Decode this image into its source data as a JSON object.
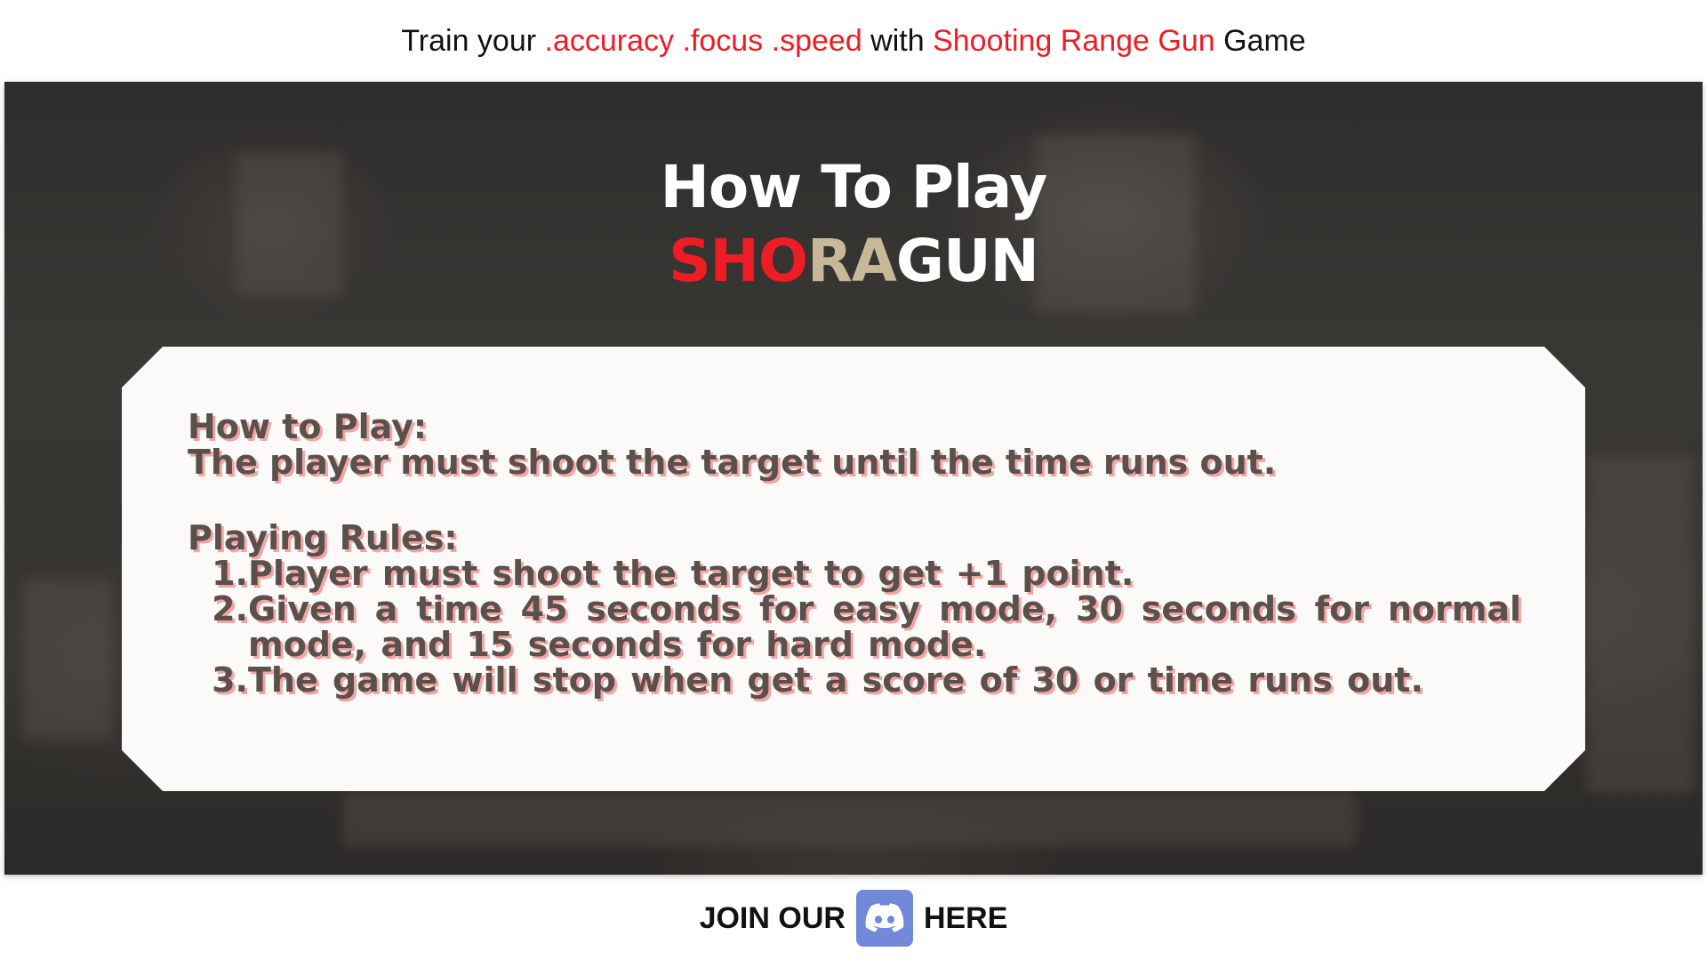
{
  "banner": {
    "prefix": "Train your ",
    "accuracy": ".accuracy",
    "focus": ".focus",
    "speed": ".speed",
    "with": " with ",
    "game_name": "Shooting Range Gun",
    "suffix": " Game"
  },
  "title": {
    "line1": "How To Play",
    "logo_part1": "SHO",
    "logo_part2": "RA",
    "logo_part3": "GUN"
  },
  "card": {
    "how_heading": "How to Play:",
    "how_text": "The player must shoot the target until the time runs out.",
    "rules_heading": "Playing Rules:",
    "rules": [
      {
        "num": "1.",
        "text": "Player must shoot the target to get +1 point."
      },
      {
        "num": "2.",
        "text": "Given a time 45 seconds for easy mode, 30 seconds for normal mode, and 15 seconds for hard mode."
      },
      {
        "num": "3.",
        "text": "The game will stop when get a score of 30 or time runs out."
      }
    ]
  },
  "footer": {
    "join_text": "JOIN OUR",
    "here_text": "HERE",
    "icon": "discord-icon"
  },
  "colors": {
    "accent_red": "#ee1c25",
    "logo_tan": "#c8b89a",
    "discord": "#7289da",
    "card_bg": "#fbfaf8",
    "card_text": "#5a504c",
    "card_shadow": "#f5a3a3"
  }
}
